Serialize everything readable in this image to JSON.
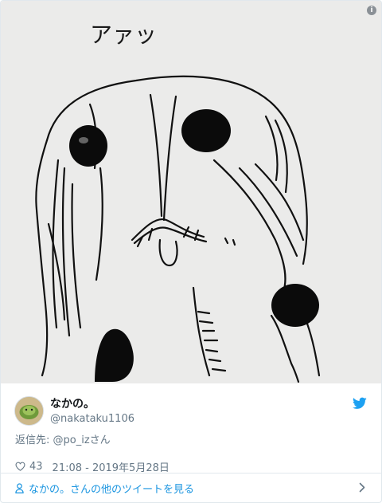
{
  "image": {
    "handwritten_text": "アァッ",
    "info_icon": "info-icon"
  },
  "author": {
    "display_name": "なかの。",
    "handle": "@nakataku1106",
    "avatar_icon": "avatar"
  },
  "reply": {
    "prefix": "返信先: ",
    "to": "@po_izさん"
  },
  "meta": {
    "likes": "43",
    "timestamp": "21:08 - 2019年5月28日",
    "heart_icon": "heart-icon"
  },
  "footer": {
    "more_tweets": "なかの。さんの他のツイートを見る",
    "person_icon": "person-icon",
    "chevron_icon": "chevron-right-icon"
  },
  "colors": {
    "link": "#1b95e0",
    "muted": "#657786",
    "text": "#14171a",
    "twitter_blue": "#1da1f2"
  }
}
